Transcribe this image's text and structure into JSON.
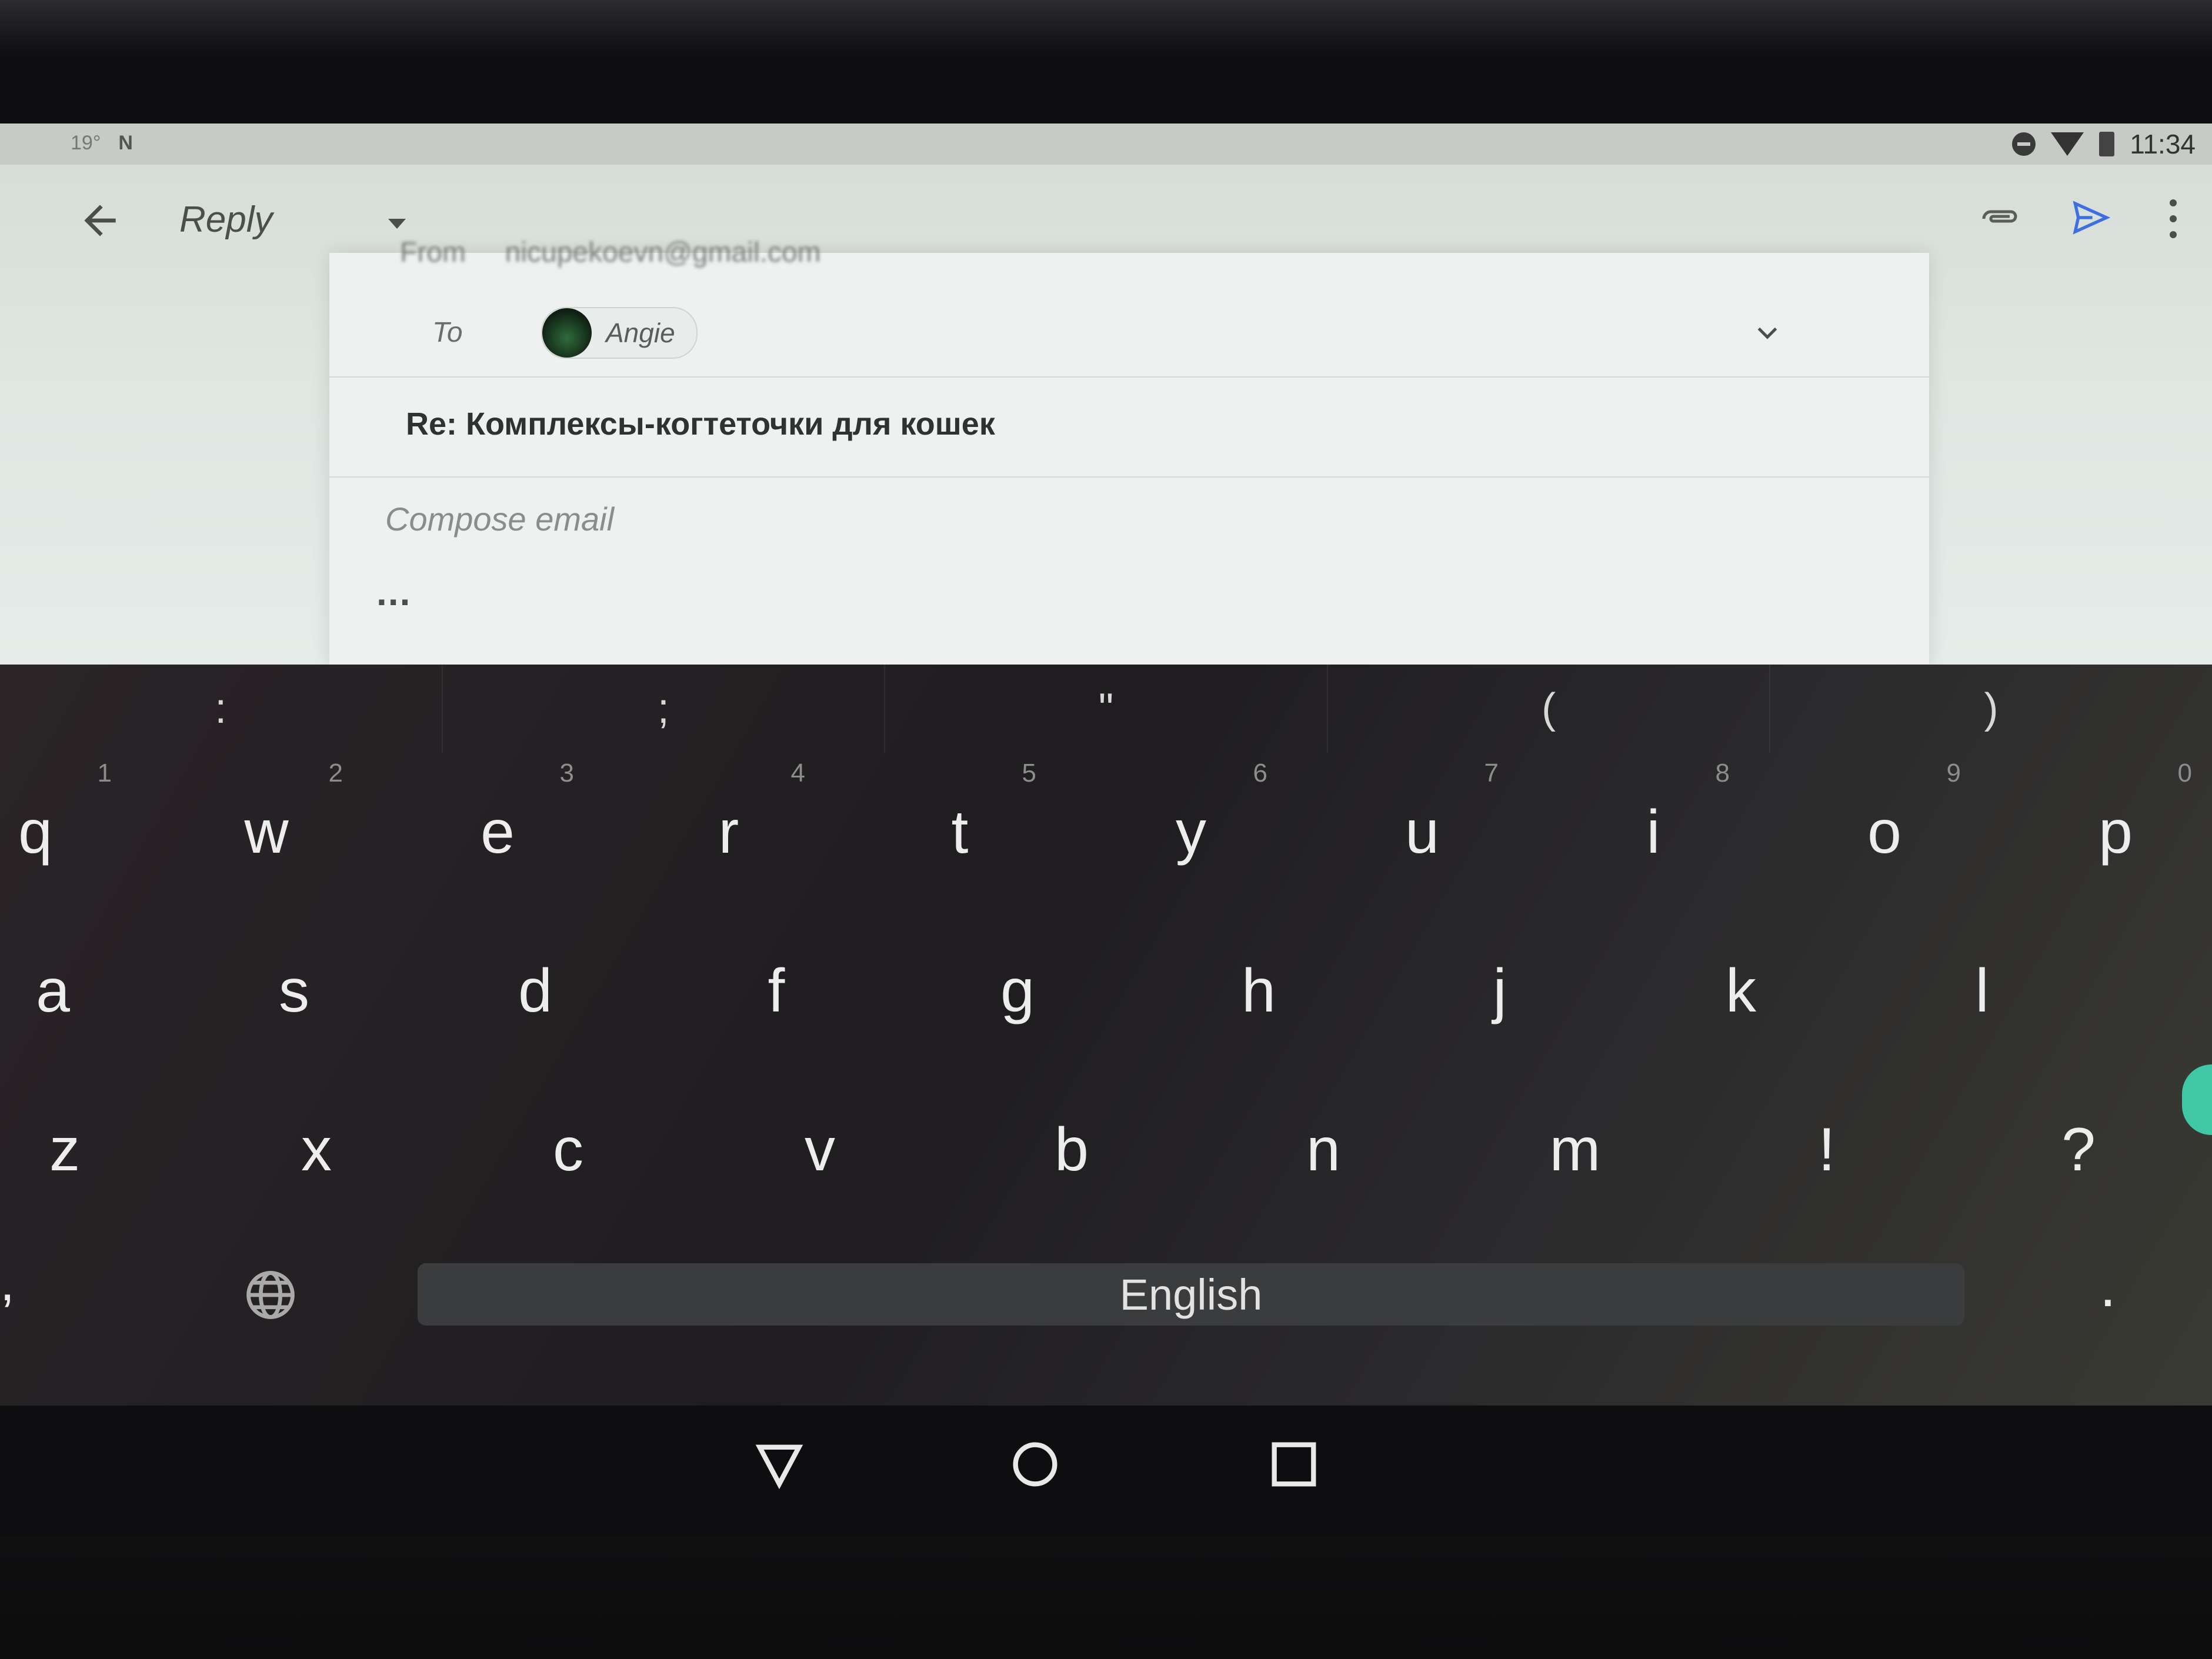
{
  "status_bar": {
    "left_text": "19°",
    "time": "11:34"
  },
  "toolbar": {
    "back_icon": "arrow-back-icon",
    "title": "Reply",
    "actions": [
      "attach-icon",
      "send-icon",
      "more-vert-icon"
    ],
    "send_color": "#3d6fe0"
  },
  "compose": {
    "from_label": "From",
    "from_value": "nicupekoevn@gmail.com",
    "to_label": "To",
    "recipient_name": "Angie",
    "subject": "Re: Комплексы-когтеточки для кошек",
    "body_placeholder": "Compose email",
    "quoted_ellipsis": "..."
  },
  "keyboard": {
    "suggestions": [
      ":",
      ";",
      "\"",
      "(",
      ")"
    ],
    "row1": [
      {
        "key": "q",
        "hint": "1"
      },
      {
        "key": "w",
        "hint": "2"
      },
      {
        "key": "e",
        "hint": "3"
      },
      {
        "key": "r",
        "hint": "4"
      },
      {
        "key": "t",
        "hint": "5"
      },
      {
        "key": "y",
        "hint": "6"
      },
      {
        "key": "u",
        "hint": "7"
      },
      {
        "key": "i",
        "hint": "8"
      },
      {
        "key": "o",
        "hint": "9"
      },
      {
        "key": "p",
        "hint": "0"
      }
    ],
    "row2": [
      "a",
      "s",
      "d",
      "f",
      "g",
      "h",
      "j",
      "k",
      "l"
    ],
    "row3": [
      "z",
      "x",
      "c",
      "v",
      "b",
      "n",
      "m",
      "!",
      "?"
    ],
    "comma": ",",
    "space_label": "English",
    "period": ".",
    "globe_icon": "globe-icon",
    "accent_color": "#3fc7a6"
  },
  "nav_bar": {
    "icons": [
      "back-triangle-icon",
      "home-circle-icon",
      "recents-square-icon"
    ]
  }
}
